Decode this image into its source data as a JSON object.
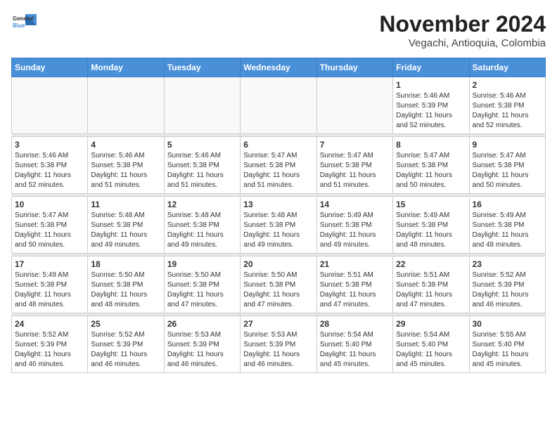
{
  "header": {
    "logo_line1": "General",
    "logo_line2": "Blue",
    "month": "November 2024",
    "location": "Vegachi, Antioquia, Colombia"
  },
  "weekdays": [
    "Sunday",
    "Monday",
    "Tuesday",
    "Wednesday",
    "Thursday",
    "Friday",
    "Saturday"
  ],
  "weeks": [
    [
      {
        "day": "",
        "info": ""
      },
      {
        "day": "",
        "info": ""
      },
      {
        "day": "",
        "info": ""
      },
      {
        "day": "",
        "info": ""
      },
      {
        "day": "",
        "info": ""
      },
      {
        "day": "1",
        "info": "Sunrise: 5:46 AM\nSunset: 5:39 PM\nDaylight: 11 hours\nand 52 minutes."
      },
      {
        "day": "2",
        "info": "Sunrise: 5:46 AM\nSunset: 5:38 PM\nDaylight: 11 hours\nand 52 minutes."
      }
    ],
    [
      {
        "day": "3",
        "info": "Sunrise: 5:46 AM\nSunset: 5:38 PM\nDaylight: 11 hours\nand 52 minutes."
      },
      {
        "day": "4",
        "info": "Sunrise: 5:46 AM\nSunset: 5:38 PM\nDaylight: 11 hours\nand 51 minutes."
      },
      {
        "day": "5",
        "info": "Sunrise: 5:46 AM\nSunset: 5:38 PM\nDaylight: 11 hours\nand 51 minutes."
      },
      {
        "day": "6",
        "info": "Sunrise: 5:47 AM\nSunset: 5:38 PM\nDaylight: 11 hours\nand 51 minutes."
      },
      {
        "day": "7",
        "info": "Sunrise: 5:47 AM\nSunset: 5:38 PM\nDaylight: 11 hours\nand 51 minutes."
      },
      {
        "day": "8",
        "info": "Sunrise: 5:47 AM\nSunset: 5:38 PM\nDaylight: 11 hours\nand 50 minutes."
      },
      {
        "day": "9",
        "info": "Sunrise: 5:47 AM\nSunset: 5:38 PM\nDaylight: 11 hours\nand 50 minutes."
      }
    ],
    [
      {
        "day": "10",
        "info": "Sunrise: 5:47 AM\nSunset: 5:38 PM\nDaylight: 11 hours\nand 50 minutes."
      },
      {
        "day": "11",
        "info": "Sunrise: 5:48 AM\nSunset: 5:38 PM\nDaylight: 11 hours\nand 49 minutes."
      },
      {
        "day": "12",
        "info": "Sunrise: 5:48 AM\nSunset: 5:38 PM\nDaylight: 11 hours\nand 49 minutes."
      },
      {
        "day": "13",
        "info": "Sunrise: 5:48 AM\nSunset: 5:38 PM\nDaylight: 11 hours\nand 49 minutes."
      },
      {
        "day": "14",
        "info": "Sunrise: 5:49 AM\nSunset: 5:38 PM\nDaylight: 11 hours\nand 49 minutes."
      },
      {
        "day": "15",
        "info": "Sunrise: 5:49 AM\nSunset: 5:38 PM\nDaylight: 11 hours\nand 48 minutes."
      },
      {
        "day": "16",
        "info": "Sunrise: 5:49 AM\nSunset: 5:38 PM\nDaylight: 11 hours\nand 48 minutes."
      }
    ],
    [
      {
        "day": "17",
        "info": "Sunrise: 5:49 AM\nSunset: 5:38 PM\nDaylight: 11 hours\nand 48 minutes."
      },
      {
        "day": "18",
        "info": "Sunrise: 5:50 AM\nSunset: 5:38 PM\nDaylight: 11 hours\nand 48 minutes."
      },
      {
        "day": "19",
        "info": "Sunrise: 5:50 AM\nSunset: 5:38 PM\nDaylight: 11 hours\nand 47 minutes."
      },
      {
        "day": "20",
        "info": "Sunrise: 5:50 AM\nSunset: 5:38 PM\nDaylight: 11 hours\nand 47 minutes."
      },
      {
        "day": "21",
        "info": "Sunrise: 5:51 AM\nSunset: 5:38 PM\nDaylight: 11 hours\nand 47 minutes."
      },
      {
        "day": "22",
        "info": "Sunrise: 5:51 AM\nSunset: 5:38 PM\nDaylight: 11 hours\nand 47 minutes."
      },
      {
        "day": "23",
        "info": "Sunrise: 5:52 AM\nSunset: 5:39 PM\nDaylight: 11 hours\nand 46 minutes."
      }
    ],
    [
      {
        "day": "24",
        "info": "Sunrise: 5:52 AM\nSunset: 5:39 PM\nDaylight: 11 hours\nand 46 minutes."
      },
      {
        "day": "25",
        "info": "Sunrise: 5:52 AM\nSunset: 5:39 PM\nDaylight: 11 hours\nand 46 minutes."
      },
      {
        "day": "26",
        "info": "Sunrise: 5:53 AM\nSunset: 5:39 PM\nDaylight: 11 hours\nand 46 minutes."
      },
      {
        "day": "27",
        "info": "Sunrise: 5:53 AM\nSunset: 5:39 PM\nDaylight: 11 hours\nand 46 minutes."
      },
      {
        "day": "28",
        "info": "Sunrise: 5:54 AM\nSunset: 5:40 PM\nDaylight: 11 hours\nand 45 minutes."
      },
      {
        "day": "29",
        "info": "Sunrise: 5:54 AM\nSunset: 5:40 PM\nDaylight: 11 hours\nand 45 minutes."
      },
      {
        "day": "30",
        "info": "Sunrise: 5:55 AM\nSunset: 5:40 PM\nDaylight: 11 hours\nand 45 minutes."
      }
    ]
  ]
}
